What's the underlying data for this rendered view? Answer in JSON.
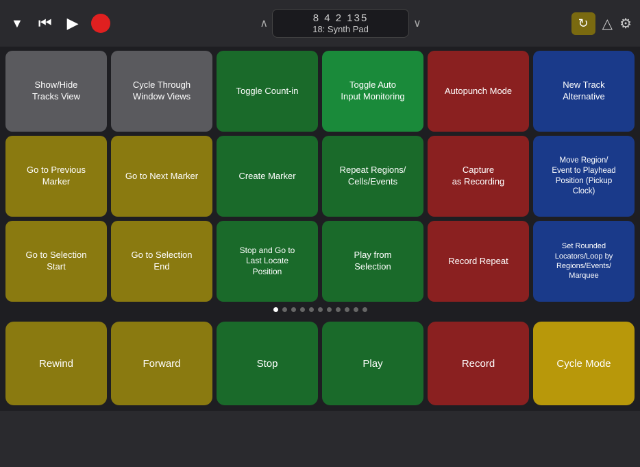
{
  "topbar": {
    "dropdown_arrow_left": "▼",
    "rewind_icon": "⏮",
    "play_icon": "▶",
    "transport_up": "∧",
    "transport_down": "∨",
    "transport_time": "8  4  2  135",
    "transport_track": "18: Synth Pad",
    "cycle_icon": "🔁",
    "metronome_icon": "△",
    "gear_icon": "⚙"
  },
  "grid": {
    "rows": [
      [
        {
          "label": "Show/Hide\nTracks View",
          "color": "gray"
        },
        {
          "label": "Cycle Through\nWindow Views",
          "color": "gray"
        },
        {
          "label": "Toggle Count-in",
          "color": "green"
        },
        {
          "label": "Toggle Auto\nInput Monitoring",
          "color": "bright-green"
        },
        {
          "label": "Autopunch Mode",
          "color": "red"
        },
        {
          "label": "New Track\nAlternative",
          "color": "blue"
        }
      ],
      [
        {
          "label": "Go to Previous\nMarker",
          "color": "olive"
        },
        {
          "label": "Go to Next Marker",
          "color": "olive"
        },
        {
          "label": "Create Marker",
          "color": "green"
        },
        {
          "label": "Repeat Regions/\nCells/Events",
          "color": "green"
        },
        {
          "label": "Capture\nas Recording",
          "color": "red"
        },
        {
          "label": "Move Region/\nEvent to Playhead\nPosition (Pickup\nClock)",
          "color": "blue"
        }
      ],
      [
        {
          "label": "Go to Selection\nStart",
          "color": "olive"
        },
        {
          "label": "Go to Selection\nEnd",
          "color": "olive"
        },
        {
          "label": "Stop and Go to\nLast Locate\nPosition",
          "color": "green"
        },
        {
          "label": "Play from\nSelection",
          "color": "green"
        },
        {
          "label": "Record Repeat",
          "color": "red"
        },
        {
          "label": "Set Rounded\nLocators/Loop by\nRegions/Events/\nMarquee",
          "color": "blue"
        }
      ]
    ]
  },
  "pagination": {
    "total": 11,
    "active": 0
  },
  "bottom_row": [
    {
      "label": "Rewind",
      "color": "olive"
    },
    {
      "label": "Forward",
      "color": "olive"
    },
    {
      "label": "Stop",
      "color": "green"
    },
    {
      "label": "Play",
      "color": "green"
    },
    {
      "label": "Record",
      "color": "red"
    },
    {
      "label": "Cycle Mode",
      "color": "gold"
    }
  ]
}
